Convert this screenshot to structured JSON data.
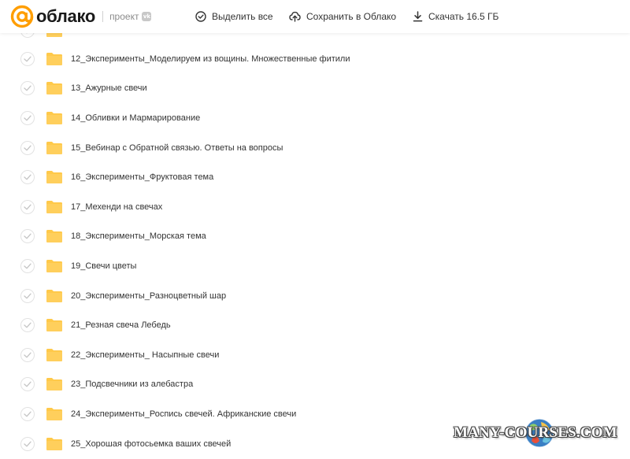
{
  "header": {
    "logo_text": "облако",
    "project_label": "проект",
    "vk_badge": "vk",
    "actions": {
      "select_all": "Выделить все",
      "save_to_cloud": "Сохранить в Облако",
      "download": "Скачать 16.5 ГБ"
    }
  },
  "colors": {
    "brand_orange": "#ff9e00",
    "folder_yellow": "#ffc94a",
    "text": "#333333",
    "muted": "#8c8c8c"
  },
  "files": {
    "partial_top": "",
    "items": [
      "12_Эксперименты_Моделируем из вощины. Множественные фитили",
      "13_Ажурные свечи",
      "14_Обливки и Мармарирование",
      "15_Вебинар с Обратной связью. Ответы на вопросы",
      "16_Эксперименты_Фруктовая тема",
      "17_Мехенди на свечах",
      "18_Эксперименты_Морская тема",
      "19_Свечи цветы",
      "20_Эксперименты_Разноцветный шар",
      "21_Резная свеча Лебедь",
      "22_Эксперименты_ Насыпные свечи",
      "23_Подсвечники из алебастра",
      "24_Эксперименты_Роспись свечей. Африканские свечи",
      "25_Хорошая фотосьемка ваших свечей"
    ]
  },
  "watermark": {
    "text": "MANY-COURSES.COM"
  }
}
